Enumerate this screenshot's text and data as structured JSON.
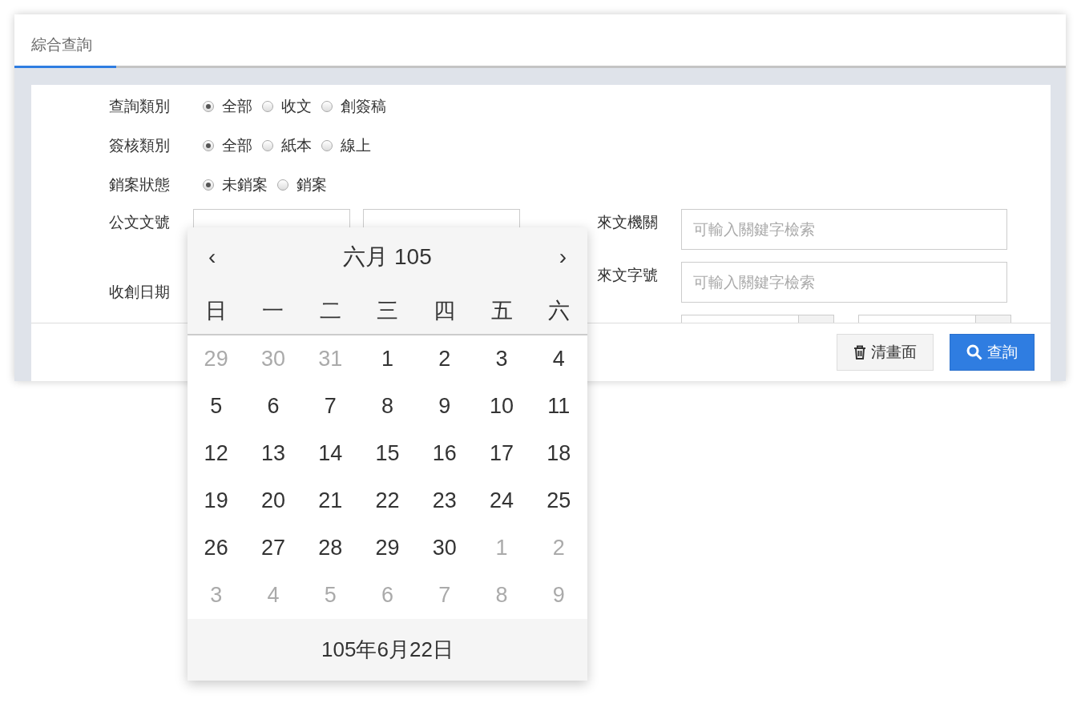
{
  "tab": {
    "label": "綜合查詢",
    "selected": true
  },
  "radio_groups": [
    {
      "label": "查詢類別",
      "options": [
        {
          "label": "全部",
          "selected": true
        },
        {
          "label": "收文",
          "selected": false
        },
        {
          "label": "創簽稿",
          "selected": false
        }
      ]
    },
    {
      "label": "簽核類別",
      "options": [
        {
          "label": "全部",
          "selected": true
        },
        {
          "label": "紙本",
          "selected": false
        },
        {
          "label": "線上",
          "selected": false
        }
      ]
    },
    {
      "label": "銷案狀態",
      "options": [
        {
          "label": "未銷案",
          "selected": true
        },
        {
          "label": "銷案",
          "selected": false
        }
      ]
    }
  ],
  "doc_number": {
    "label": "公文文號",
    "inputs": [
      {
        "kind": "text"
      },
      {
        "kind": "text"
      }
    ]
  },
  "receive_date": {
    "label": "收創日期"
  },
  "right_fields": [
    {
      "label": "來文機關",
      "placeholder": "可輸入關鍵字檢索"
    },
    {
      "label": "來文字號",
      "placeholder": "可輸入關鍵字檢索"
    }
  ],
  "buttons": [
    {
      "label": "清畫面",
      "kind": "clear"
    },
    {
      "label": "查詢",
      "kind": "search"
    }
  ],
  "datepicker": {
    "title": "六月 105",
    "prev": "‹",
    "next": "›",
    "weekdays": [
      "日",
      "一",
      "二",
      "三",
      "四",
      "五",
      "六"
    ],
    "days": [
      {
        "day": "29",
        "outside": true
      },
      {
        "day": "30",
        "outside": true
      },
      {
        "day": "31",
        "outside": true
      },
      {
        "day": "1",
        "outside": false
      },
      {
        "day": "2",
        "outside": false
      },
      {
        "day": "3",
        "outside": false
      },
      {
        "day": "4",
        "outside": false
      },
      {
        "day": "5",
        "outside": false
      },
      {
        "day": "6",
        "outside": false
      },
      {
        "day": "7",
        "outside": false
      },
      {
        "day": "8",
        "outside": false
      },
      {
        "day": "9",
        "outside": false
      },
      {
        "day": "10",
        "outside": false
      },
      {
        "day": "11",
        "outside": false
      },
      {
        "day": "12",
        "outside": false
      },
      {
        "day": "13",
        "outside": false
      },
      {
        "day": "14",
        "outside": false
      },
      {
        "day": "15",
        "outside": false
      },
      {
        "day": "16",
        "outside": false
      },
      {
        "day": "17",
        "outside": false
      },
      {
        "day": "18",
        "outside": false
      },
      {
        "day": "19",
        "outside": false
      },
      {
        "day": "20",
        "outside": false
      },
      {
        "day": "21",
        "outside": false
      },
      {
        "day": "22",
        "outside": false
      },
      {
        "day": "23",
        "outside": false
      },
      {
        "day": "24",
        "outside": false
      },
      {
        "day": "25",
        "outside": false
      },
      {
        "day": "26",
        "outside": false
      },
      {
        "day": "27",
        "outside": false
      },
      {
        "day": "28",
        "outside": false
      },
      {
        "day": "29",
        "outside": false
      },
      {
        "day": "30",
        "outside": false
      },
      {
        "day": "1",
        "outside": true
      },
      {
        "day": "2",
        "outside": true
      },
      {
        "day": "3",
        "outside": true
      },
      {
        "day": "4",
        "outside": true
      },
      {
        "day": "5",
        "outside": true
      },
      {
        "day": "6",
        "outside": true
      },
      {
        "day": "7",
        "outside": true
      },
      {
        "day": "8",
        "outside": true
      },
      {
        "day": "9",
        "outside": true
      }
    ],
    "footer": "105年6月22日"
  }
}
